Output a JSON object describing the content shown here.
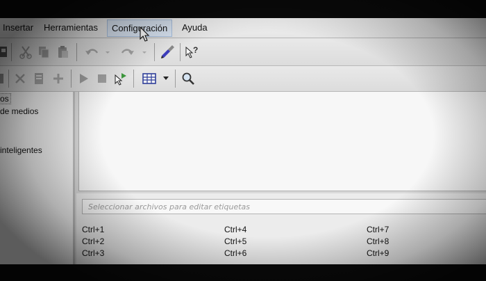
{
  "menubar": {
    "items": [
      {
        "label": "Insertar"
      },
      {
        "label": "Herramientas"
      },
      {
        "label": "Configuración"
      },
      {
        "label": "Ayuda"
      }
    ]
  },
  "toolbar1": {
    "icons": [
      "save-icon",
      "cut-icon",
      "copy-icon",
      "paste-icon",
      "undo-icon",
      "redo-icon",
      "brush-icon",
      "whats-this-icon"
    ]
  },
  "toolbar2": {
    "icons": [
      "edit-icon",
      "delete-icon",
      "properties-icon",
      "add-icon",
      "play-icon",
      "stop-icon",
      "send-icon",
      "view-columns-icon",
      "dropdown-arrow-icon",
      "search-icon"
    ]
  },
  "sidebar": {
    "items": [
      {
        "label": "os"
      },
      {
        "label": "de medios"
      },
      {
        "label": "inteligentes"
      }
    ]
  },
  "tag_editor": {
    "placeholder": "Seleccionar archivos para editar etiquetas",
    "shortcuts": [
      [
        "Ctrl+1",
        "Ctrl+4",
        "Ctrl+7"
      ],
      [
        "Ctrl+2",
        "Ctrl+5",
        "Ctrl+8"
      ],
      [
        "Ctrl+3",
        "Ctrl+6",
        "Ctrl+9"
      ]
    ]
  },
  "colors": {
    "menubar_bg": "#efefef",
    "toolbar_bg": "#e0e0e0",
    "pane_bg": "#f3f3f3",
    "screen_bezel": "#0a0a0a",
    "menu_hover": "#dbe6f4"
  }
}
